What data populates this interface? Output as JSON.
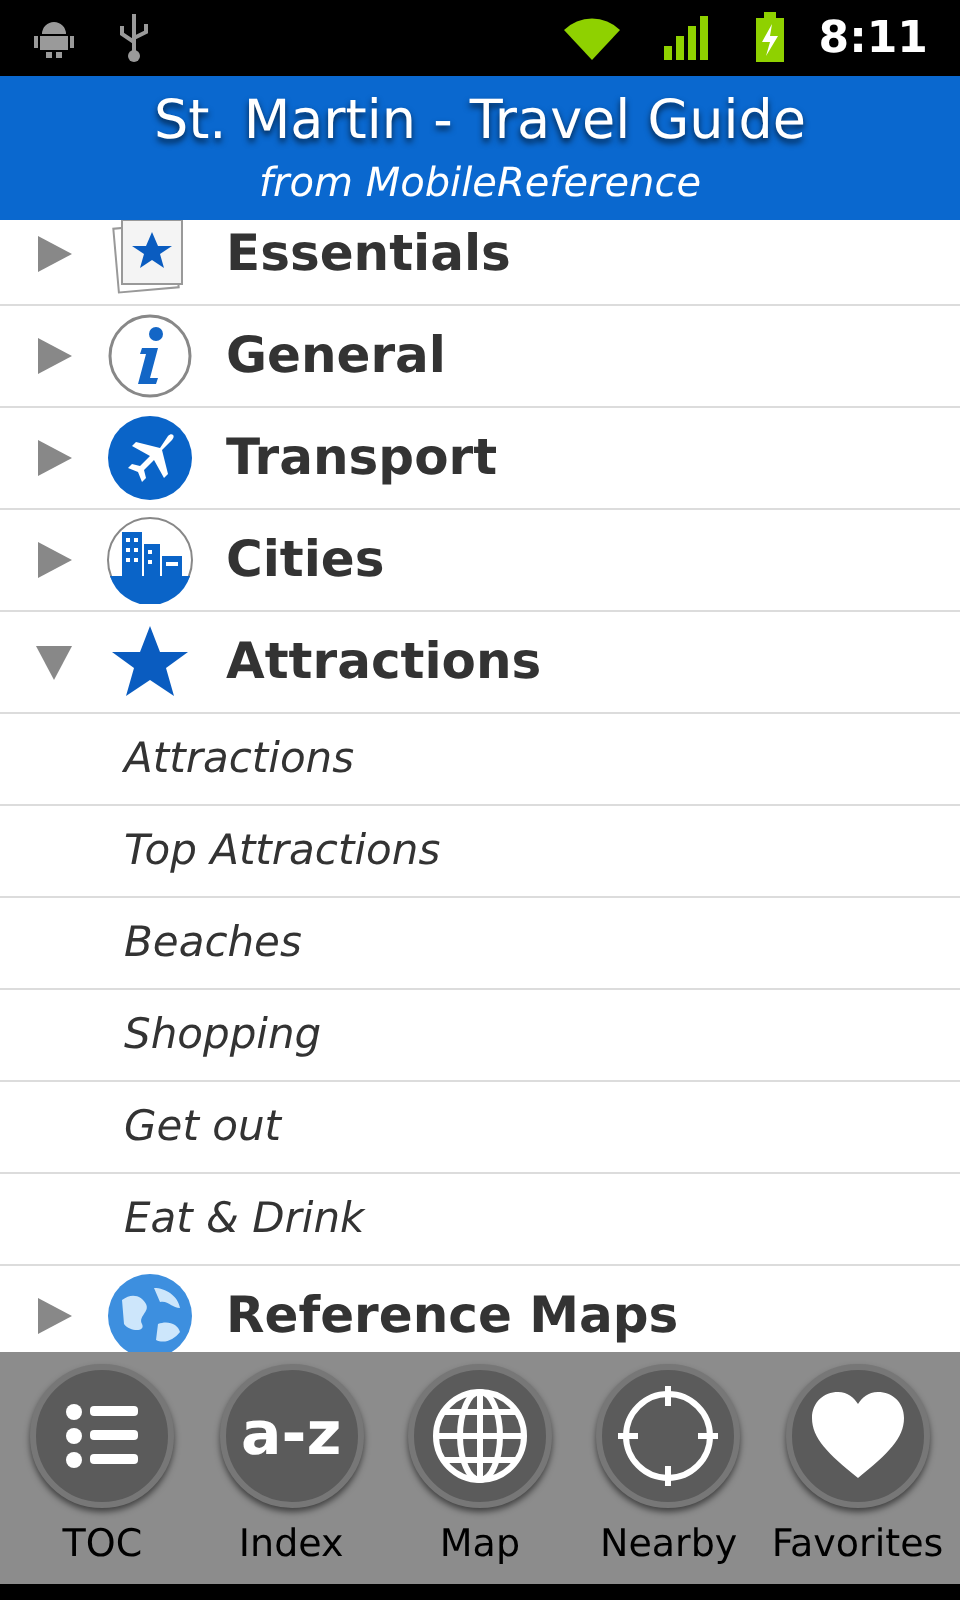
{
  "status_bar": {
    "time": "8:11"
  },
  "header": {
    "title": "St. Martin - Travel Guide",
    "subtitle": "from MobileReference"
  },
  "sections": [
    {
      "label": "Essentials",
      "kind": "essentials",
      "expanded": false
    },
    {
      "label": "General",
      "kind": "info",
      "expanded": false
    },
    {
      "label": "Transport",
      "kind": "plane",
      "expanded": false
    },
    {
      "label": "Cities",
      "kind": "city",
      "expanded": false
    },
    {
      "label": "Attractions",
      "kind": "star",
      "expanded": true,
      "children": [
        {
          "label": "Attractions"
        },
        {
          "label": "Top Attractions"
        },
        {
          "label": "Beaches"
        },
        {
          "label": "Shopping"
        },
        {
          "label": "Get out"
        },
        {
          "label": "Eat & Drink"
        }
      ]
    },
    {
      "label": "Reference Maps",
      "kind": "globe",
      "expanded": false
    }
  ],
  "toolbar": [
    {
      "label": "TOC",
      "kind": "list"
    },
    {
      "label": "Index",
      "kind": "text",
      "icon_text": "a-z"
    },
    {
      "label": "Map",
      "kind": "globe"
    },
    {
      "label": "Nearby",
      "kind": "target"
    },
    {
      "label": "Favorites",
      "kind": "heart"
    }
  ]
}
